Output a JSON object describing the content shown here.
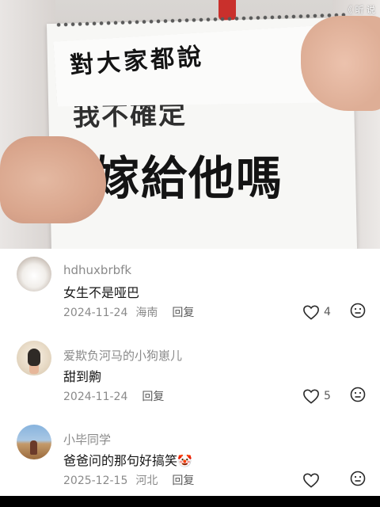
{
  "video": {
    "overlay_corner": "《 昕 说",
    "handwriting": {
      "line1": "對大家都說",
      "line2": "我不確定",
      "line3": "嫁給他嗎"
    }
  },
  "comments": [
    {
      "username": "hdhuxbrbfk",
      "text": "女生不是哑巴",
      "date": "2024-11-24",
      "location": "海南",
      "reply_label": "回复",
      "likes": "4"
    },
    {
      "username": "爱欺负河马的小狗崽儿",
      "text": "甜到齁",
      "date": "2024-11-24",
      "location": "",
      "reply_label": "回复",
      "likes": "5"
    },
    {
      "username": "小毕同学",
      "text": "爸爸问的那句好搞笑",
      "text_emoji": "🤡",
      "date": "2025-12-15",
      "location": "河北",
      "reply_label": "回复",
      "likes": ""
    }
  ],
  "icons": {
    "like": "heart-outline-icon",
    "dislike": "neutral-face-icon"
  },
  "colors": {
    "text_primary": "#161616",
    "text_secondary": "#8a8a8a"
  }
}
